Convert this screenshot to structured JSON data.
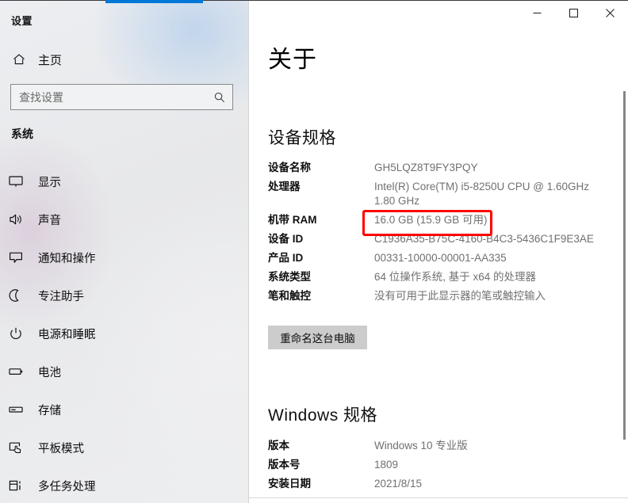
{
  "window": {
    "app_title": "设置",
    "controls": {
      "minimize": "minimize-icon",
      "maximize": "maximize-icon",
      "close": "close-icon"
    },
    "accent_color": "#0078d7"
  },
  "sidebar": {
    "home": {
      "label": "主页",
      "icon": "home-icon"
    },
    "search": {
      "placeholder": "查找设置",
      "value": "",
      "icon": "search-icon"
    },
    "group_title": "系统",
    "items": [
      {
        "label": "显示",
        "icon": "monitor-icon"
      },
      {
        "label": "声音",
        "icon": "speaker-icon"
      },
      {
        "label": "通知和操作",
        "icon": "notification-icon"
      },
      {
        "label": "专注助手",
        "icon": "moon-icon"
      },
      {
        "label": "电源和睡眠",
        "icon": "power-icon"
      },
      {
        "label": "电池",
        "icon": "battery-icon"
      },
      {
        "label": "存储",
        "icon": "storage-icon"
      },
      {
        "label": "平板模式",
        "icon": "tablet-mode-icon"
      },
      {
        "label": "多任务处理",
        "icon": "multitasking-icon"
      }
    ]
  },
  "main": {
    "page_title": "关于",
    "device_section": {
      "heading": "设备规格",
      "rows": [
        {
          "key": "设备名称",
          "value": "GH5LQZ8T9FY3PQY"
        },
        {
          "key": "处理器",
          "value": "Intel(R) Core(TM) i5-8250U CPU @ 1.60GHz\n1.80 GHz"
        },
        {
          "key": "机带 RAM",
          "value": "16.0 GB (15.9 GB 可用)"
        },
        {
          "key": "设备 ID",
          "value": "C1936A35-B75C-4160-B4C3-5436C1F9E3AE"
        },
        {
          "key": "产品 ID",
          "value": "00331-10000-00001-AA335"
        },
        {
          "key": "系统类型",
          "value": "64 位操作系统, 基于 x64 的处理器"
        },
        {
          "key": "笔和触控",
          "value": "没有可用于此显示器的笔或触控输入"
        }
      ],
      "rename_button": "重命名这台电脑"
    },
    "windows_section": {
      "heading": "Windows 规格",
      "rows": [
        {
          "key": "版本",
          "value": "Windows 10 专业版"
        },
        {
          "key": "版本号",
          "value": "1809"
        },
        {
          "key": "安装日期",
          "value": "2021/8/15"
        }
      ]
    },
    "annotation": {
      "type": "red-rectangle-highlight",
      "target": "机带 RAM",
      "color": "#fe0000"
    }
  }
}
